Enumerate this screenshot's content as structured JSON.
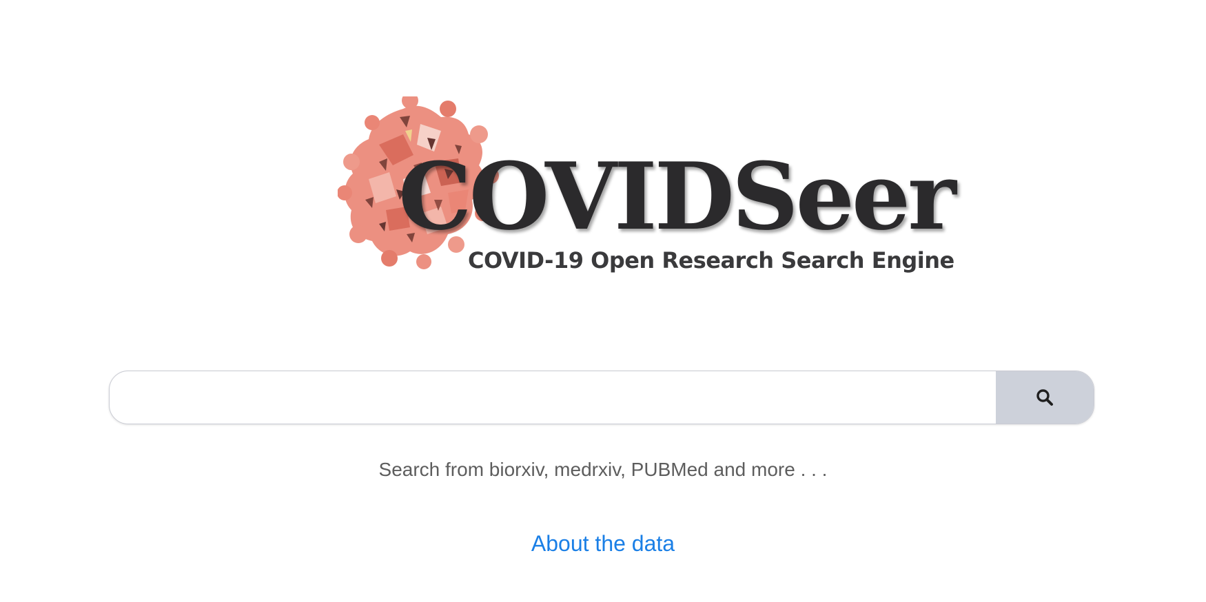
{
  "logo": {
    "wordmark": "COVIDSeer",
    "tagline": "COVID-19 Open Research Search Engine",
    "colors": {
      "wordmark": "#2b2a2c",
      "virus_primary": "#e9806f",
      "virus_dark": "#7a3a32",
      "virus_light": "#f6cfc6"
    }
  },
  "search": {
    "value": "",
    "placeholder": "",
    "button_icon": "search-icon",
    "button_color": "#cdd1da"
  },
  "hint": "Search from biorxiv, medrxiv, PUBMed and more . . .",
  "about_link": "About the data",
  "colors": {
    "link": "#1a7fe6",
    "hint": "#5d5d5d"
  }
}
